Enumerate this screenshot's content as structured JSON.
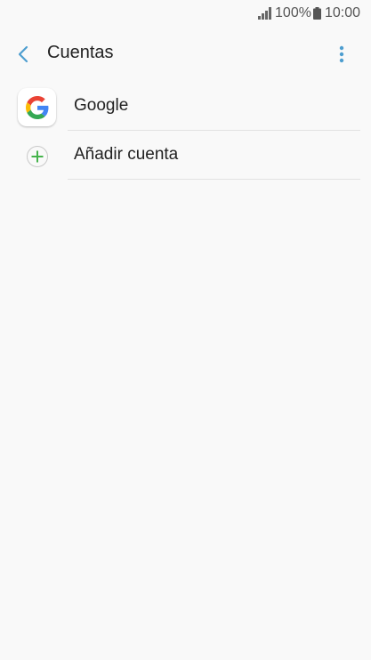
{
  "status_bar": {
    "battery": "100%",
    "time": "10:00",
    "icons": [
      "signal-icon",
      "battery-icon"
    ]
  },
  "app_bar": {
    "title": "Cuentas",
    "icons": [
      "back-arrow-icon",
      "more-vert-icon"
    ]
  },
  "accounts": [
    {
      "label": "Google",
      "icon": "google-icon"
    },
    {
      "label": "Añadir cuenta",
      "icon": "plus-circle-icon"
    }
  ],
  "colors": {
    "accent": "#4e9ed0",
    "plus_green": "#45b34b",
    "background": "#f9f9f9"
  }
}
